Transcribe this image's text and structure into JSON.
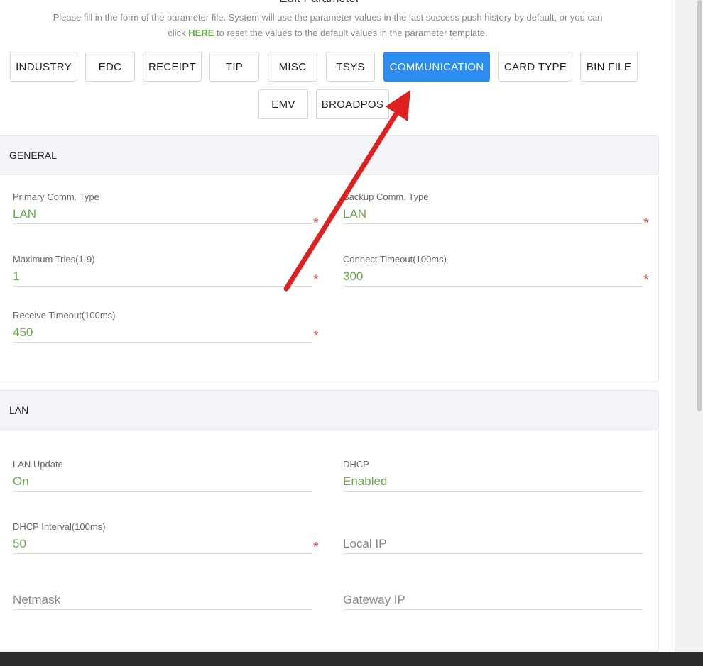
{
  "page": {
    "title": "Edit Parameter",
    "intro_line1": "Please fill in the form of the parameter file. System will use the parameter values in the last success push history by default, or you can",
    "intro_click": "click ",
    "intro_here": "HERE",
    "intro_line2": " to reset the values to the default values in the parameter template."
  },
  "tabs": [
    {
      "label": "INDUSTRY"
    },
    {
      "label": "EDC"
    },
    {
      "label": "RECEIPT"
    },
    {
      "label": "TIP"
    },
    {
      "label": "MISC"
    },
    {
      "label": "TSYS"
    },
    {
      "label": "COMMUNICATION",
      "active": true
    },
    {
      "label": "CARD TYPE"
    },
    {
      "label": "BIN FILE"
    },
    {
      "label": "EMV"
    },
    {
      "label": "BROADPOS"
    }
  ],
  "general": {
    "title": "GENERAL",
    "primary_type": {
      "label": "Primary Comm. Type",
      "value": "LAN"
    },
    "backup_type": {
      "label": "Backup Comm. Type",
      "value": "LAN"
    },
    "max_tries": {
      "label": "Maximum Tries(1-9)",
      "value": "1"
    },
    "connect_timeout": {
      "label": "Connect Timeout(100ms)",
      "value": "300"
    },
    "receive_timeout": {
      "label": "Receive Timeout(100ms)",
      "value": "450"
    }
  },
  "lan": {
    "title": "LAN",
    "lan_update": {
      "label": "LAN Update",
      "value": "On"
    },
    "dhcp": {
      "label": "DHCP",
      "value": "Enabled"
    },
    "dhcp_interval": {
      "label": "DHCP Interval(100ms)",
      "value": "50"
    },
    "local_ip": {
      "placeholder": "Local IP"
    },
    "netmask": {
      "placeholder": "Netmask"
    },
    "gateway_ip": {
      "placeholder": "Gateway IP"
    }
  },
  "required_mark": "*",
  "colors": {
    "accent": "#2d8cf0",
    "value_green": "#6aa84f",
    "required_red": "#d9534f",
    "annotation_arrow": "#e02020"
  }
}
